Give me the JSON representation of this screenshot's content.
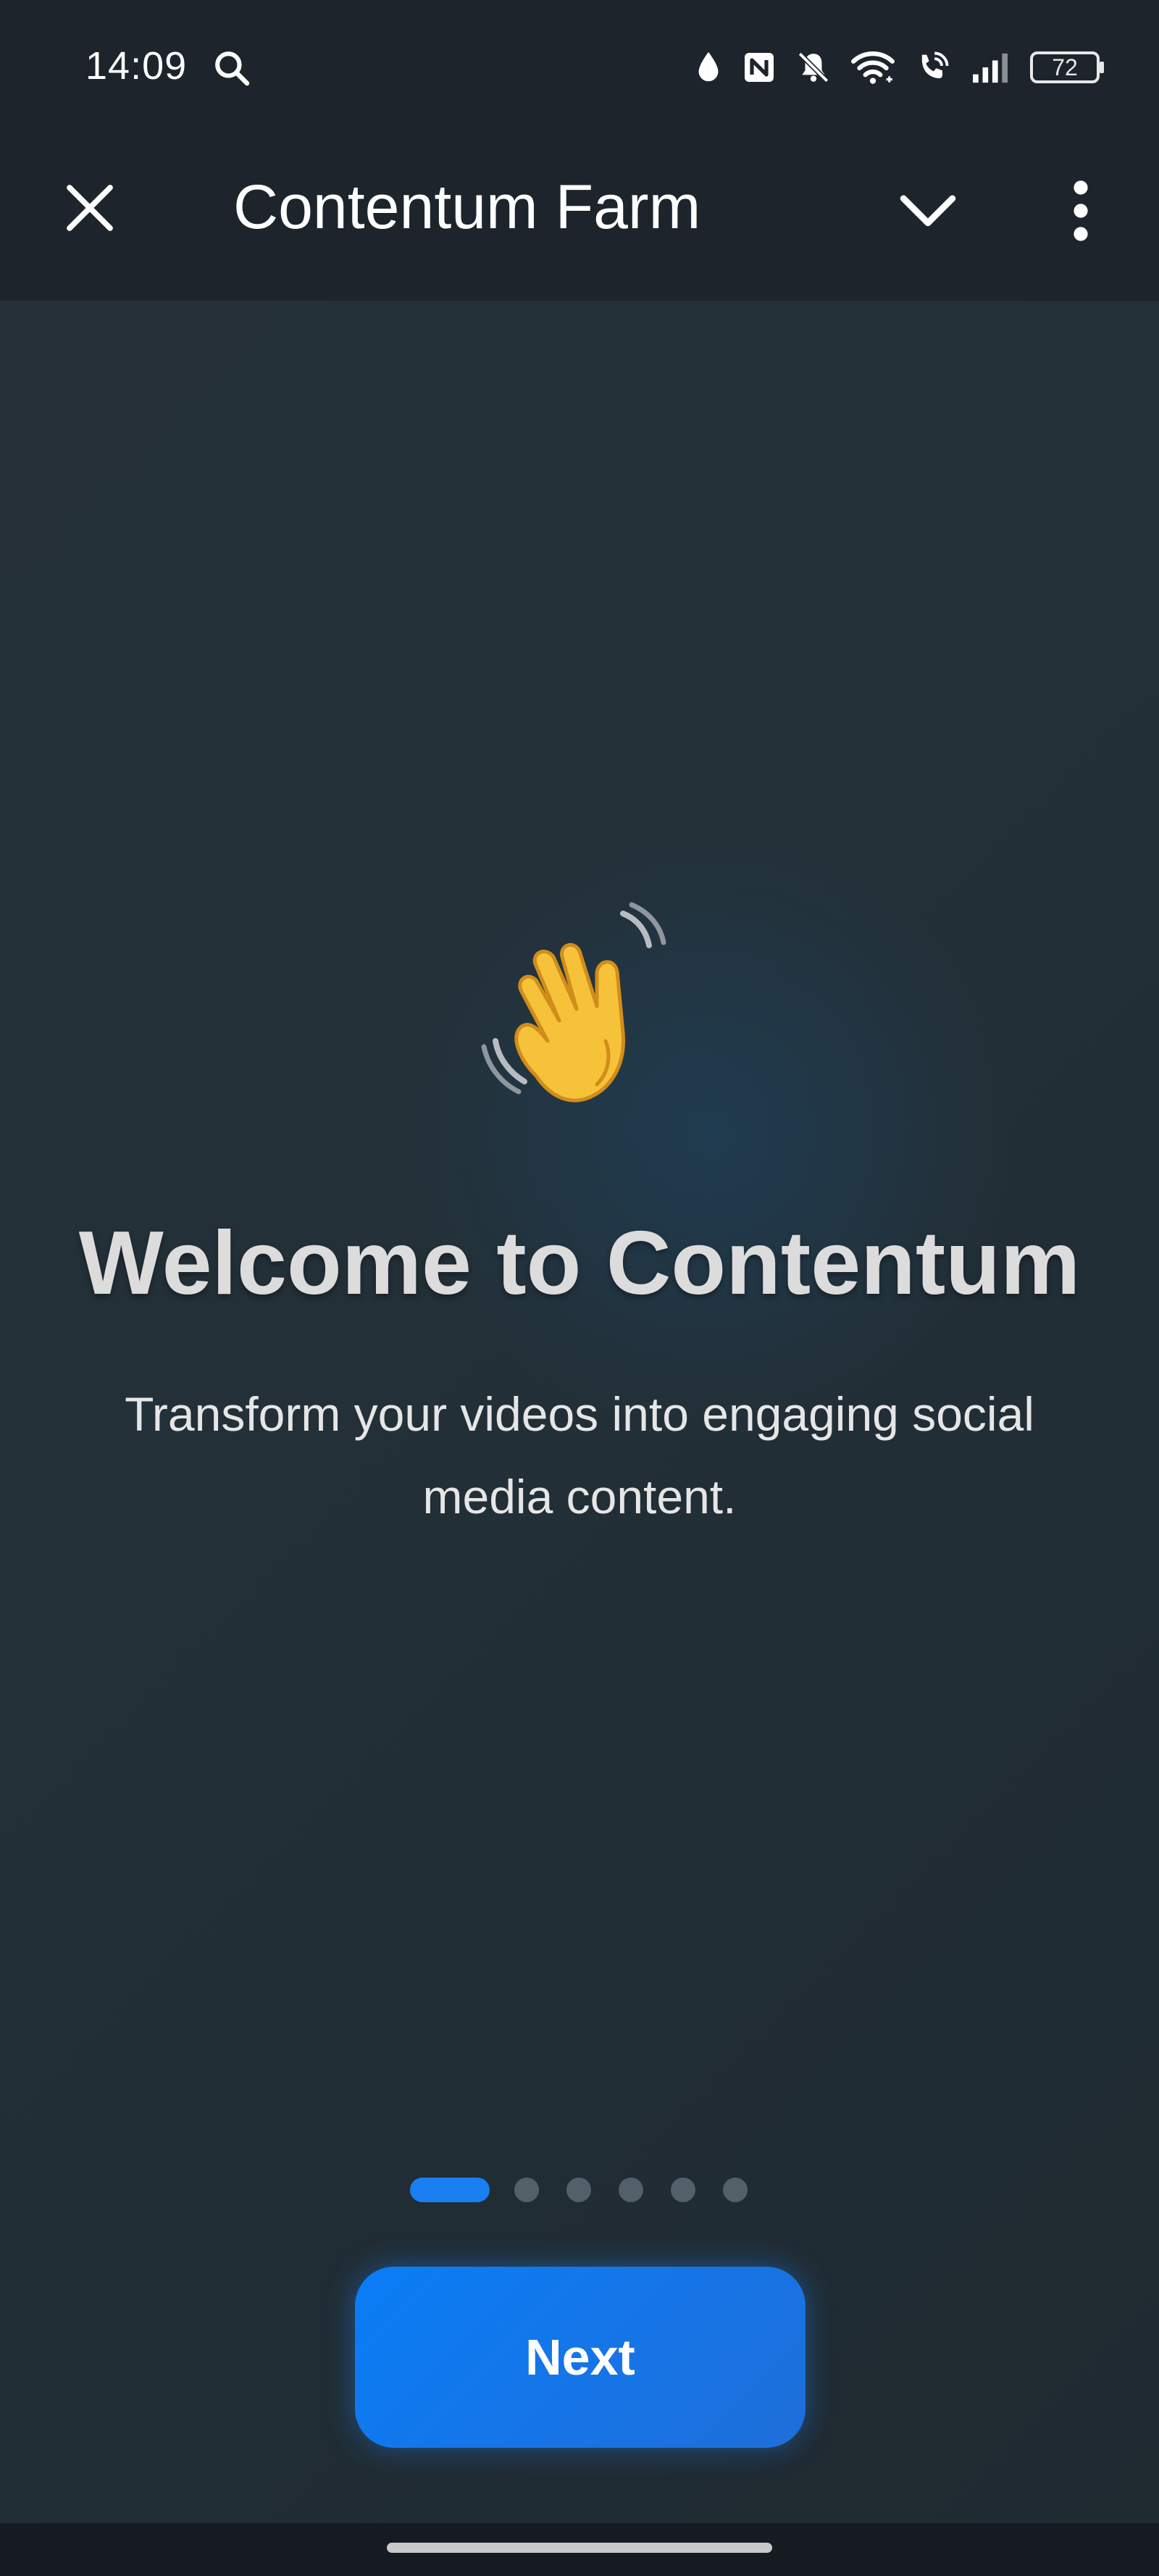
{
  "status_bar": {
    "time": "14:09",
    "battery_level": "72",
    "icons": [
      "search-icon",
      "water-drop-icon",
      "nfc-icon",
      "bell-muted-icon",
      "wifi-icon",
      "wifi-calling-icon",
      "signal-icon",
      "battery-icon"
    ]
  },
  "app_bar": {
    "title": "Contentum Farm",
    "close_icon": "close-icon",
    "collapse_icon": "chevron-down-icon",
    "more_icon": "more-vert-icon"
  },
  "onboarding": {
    "emoji": "👋",
    "title": "Welcome to Contentum",
    "subtitle": "Transform your videos into engaging social media content.",
    "page_count": 6,
    "current_page": 1,
    "next_label": "Next"
  },
  "colors": {
    "background": "#1f2931",
    "app_bar": "#1d242c",
    "accent": "#1a7ff0",
    "inactive_dot": "#53606a"
  }
}
